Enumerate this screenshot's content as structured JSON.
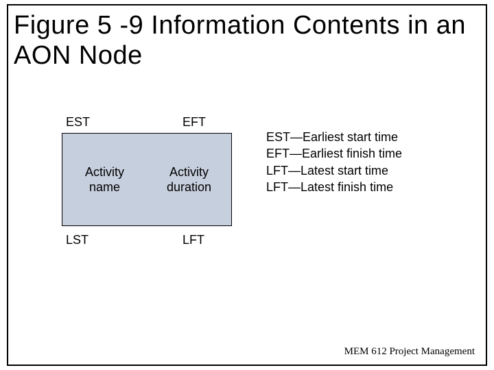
{
  "title": "Figure 5 -9 Information Contents in an AON Node",
  "labels": {
    "est": "EST",
    "eft": "EFT",
    "lst": "LST",
    "lft": "LFT"
  },
  "node": {
    "left": "Activity\nname",
    "right": "Activity\nduration"
  },
  "legend": [
    {
      "abbr": "EST",
      "def": "—Earliest start time"
    },
    {
      "abbr": "EFT",
      "def": "—Earliest finish time"
    },
    {
      "abbr": "LFT",
      "def": "—Latest start time"
    },
    {
      "abbr": "LFT",
      "def": "—Latest finish time"
    }
  ],
  "footer": "MEM 612 Project Management"
}
